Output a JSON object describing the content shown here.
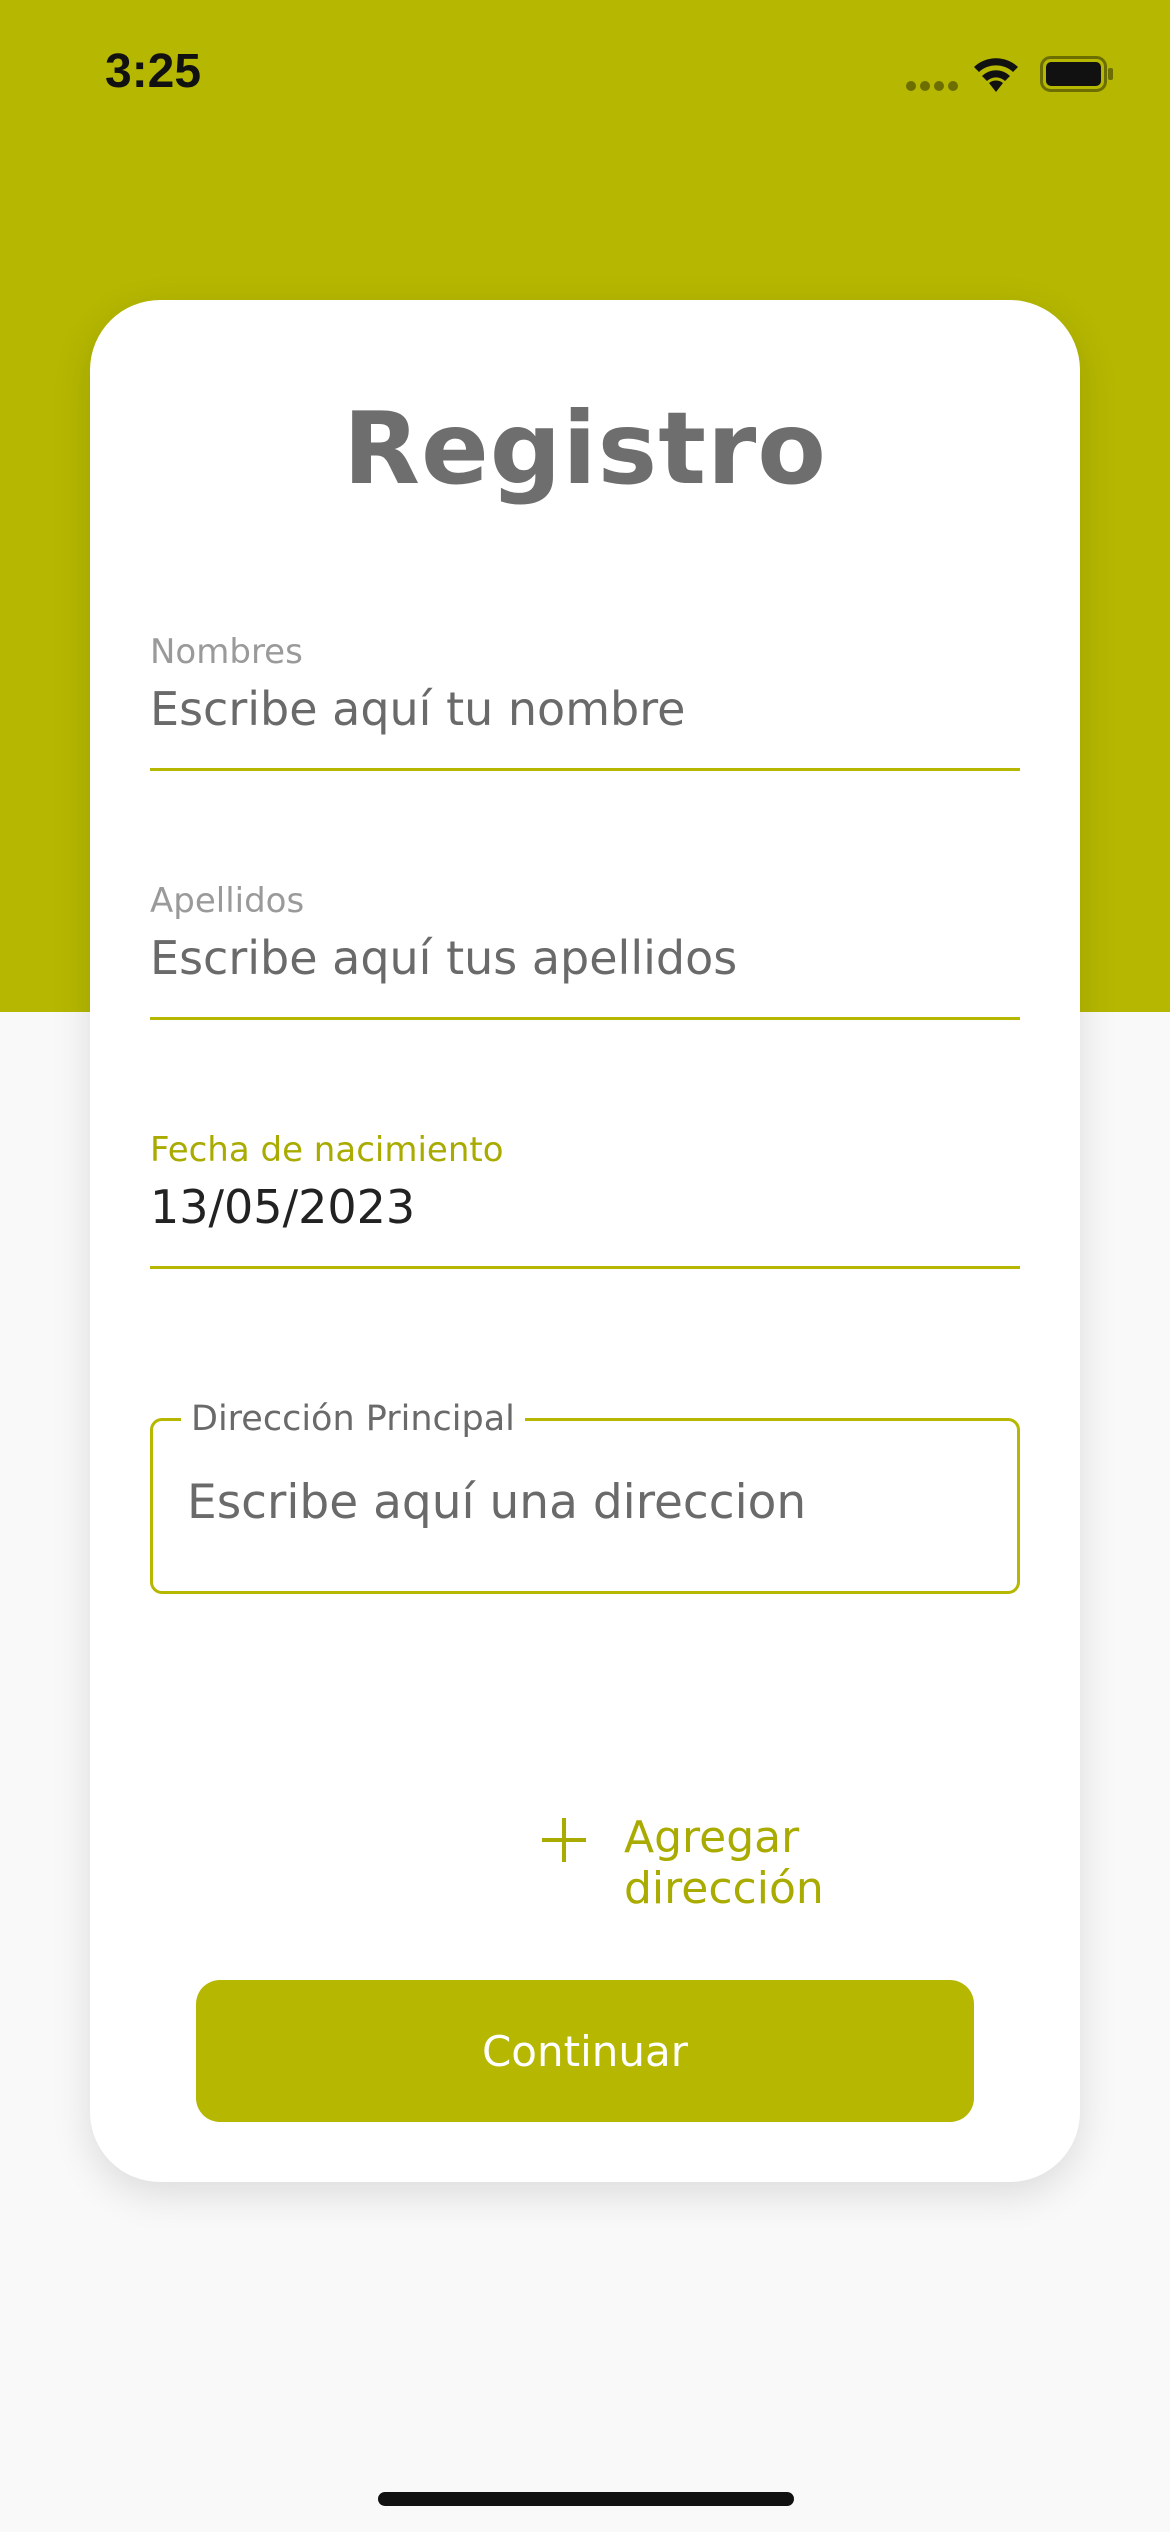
{
  "status_bar": {
    "time": "3:25"
  },
  "form": {
    "title": "Registro",
    "first_name": {
      "label": "Nombres",
      "placeholder": "Escribe aquí tu nombre"
    },
    "last_name": {
      "label": "Apellidos",
      "placeholder": "Escribe aquí tus apellidos"
    },
    "birth_date": {
      "label": "Fecha de nacimiento",
      "value": "13/05/2023"
    },
    "main_address": {
      "label": "Dirección Principal",
      "placeholder": "Escribe aquí una direccion"
    },
    "add_address_label": "Agregar dirección",
    "continue_label": "Continuar"
  },
  "colors": {
    "accent": "#b5b700",
    "background": "#f9f9f9",
    "card": "#ffffff"
  },
  "icons": [
    "signal-icon",
    "wifi-icon",
    "battery-icon",
    "plus-icon"
  ]
}
